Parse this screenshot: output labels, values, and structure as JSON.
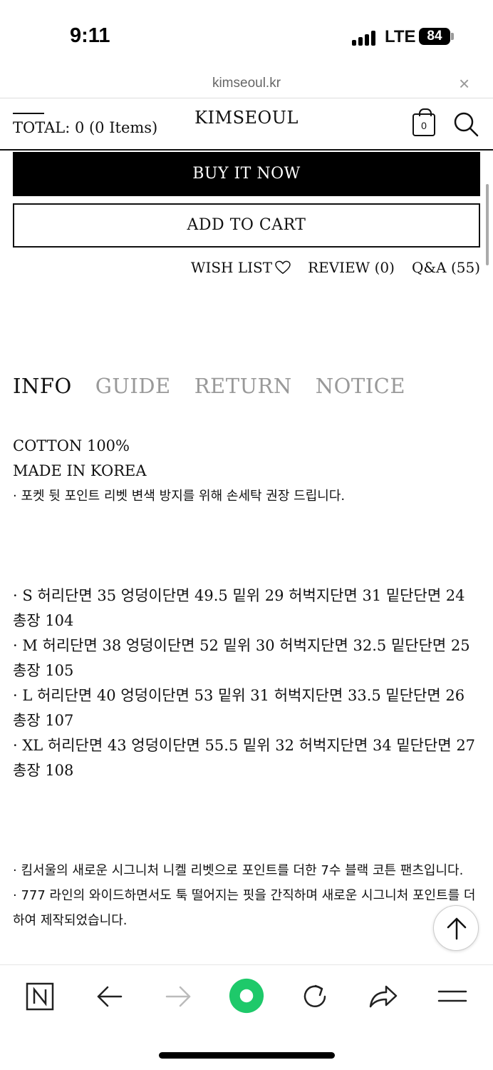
{
  "status_bar": {
    "time": "9:11",
    "network": "LTE",
    "battery": "84"
  },
  "url_bar": {
    "domain": "kimseoul.kr",
    "close_icon": "close-icon"
  },
  "header": {
    "total_label": "TOTAL: 0 (0 Items)",
    "logo": "KIMSEOUL",
    "cart_count": "0",
    "icons": [
      "shopping-bag-icon",
      "search-icon"
    ]
  },
  "actions": {
    "buy_now": "BUY IT NOW",
    "add_to_cart": "ADD TO CART",
    "wish_list": "WISH LIST",
    "review": "REVIEW (0)",
    "qa": "Q&A (55)"
  },
  "tabs": [
    {
      "label": "INFO",
      "active": true
    },
    {
      "label": "GUIDE",
      "active": false
    },
    {
      "label": "RETURN",
      "active": false
    },
    {
      "label": "NOTICE",
      "active": false
    }
  ],
  "info": {
    "material": "COTTON 100%",
    "origin": "MADE IN KOREA",
    "care_note": "· 포켓 뒷 포인트 리벳 변색 방지를 위해 손세탁 권장 드립니다.",
    "sizes": [
      "· S 허리단면 35 엉덩이단면 49.5 밑위 29 허벅지단면 31 밑단단면 24 총장 104",
      "· M 허리단면 38 엉덩이단면 52 밑위 30 허벅지단면 32.5 밑단단면 25 총장 105",
      "· L 허리단면 40 엉덩이단면 53 밑위 31 허벅지단면 33.5 밑단단면 26 총장 107",
      "· XL 허리단면 43 엉덩이단면 55.5 밑위 32 허벅지단면 34 밑단단면 27 총장 108"
    ],
    "description": [
      "· 킴서울의 새로운 시그니처 니켈 리벳으로 포인트를 더한 7수 블랙 코튼 팬츠입니다.",
      "· 777 라인의 와이드하면서도 툭 떨어지는 핏을 간직하며 새로운 시그니처 포인트를 더하여 제작되었습니다."
    ]
  },
  "toolbar": [
    "naver-icon",
    "back-arrow-icon",
    "forward-arrow-icon",
    "green-dot-icon",
    "reload-icon",
    "share-icon",
    "menu-icon"
  ],
  "colors": {
    "accent_green": "#1ec96a",
    "text": "#111111",
    "inactive_tab": "#999999"
  }
}
